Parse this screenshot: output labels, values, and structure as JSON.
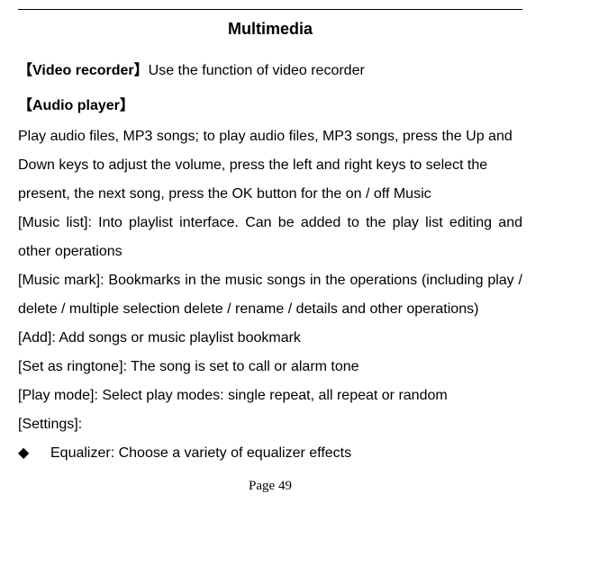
{
  "title": "Multimedia",
  "video_recorder": {
    "heading": "【Video recorder】",
    "text": "Use the function of video recorder"
  },
  "audio_player": {
    "heading": "【Audio player】",
    "intro": "Play audio files, MP3 songs; to play audio files, MP3 songs, press the Up and Down keys to adjust the volume, press the left and right keys to select the present, the next song, press the OK button for the on / off Music",
    "items": [
      "[Music list]: Into playlist interface. Can be added to the play list editing and other operations",
      "[Music mark]: Bookmarks in the music songs in the operations (including play / delete / multiple selection delete / rename / details and other operations)",
      "[Add]: Add songs or music playlist bookmark",
      "[Set as ringtone]: The song is set to call or alarm tone",
      "[Play mode]: Select play modes: single repeat, all repeat or random",
      "[Settings]:"
    ],
    "bullet": {
      "symbol": "◆",
      "text": "Equalizer: Choose a variety of equalizer effects"
    }
  },
  "footer": "Page 49"
}
